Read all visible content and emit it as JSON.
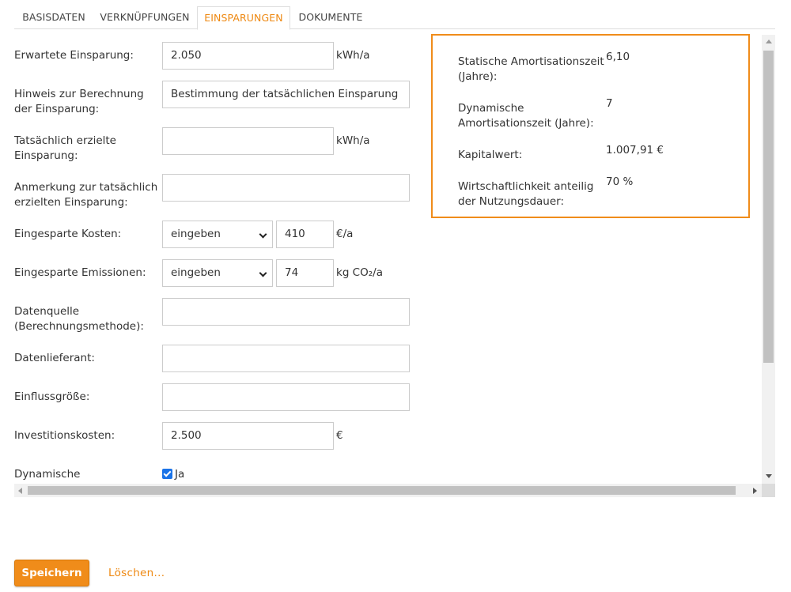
{
  "tabs": [
    {
      "label": "BASISDATEN",
      "active": false
    },
    {
      "label": "VERKNÜPFUNGEN",
      "active": false
    },
    {
      "label": "EINSPARUNGEN",
      "active": true
    },
    {
      "label": "DOKUMENTE",
      "active": false
    }
  ],
  "colors": {
    "accent": "#f08c1a",
    "checkbox": "#1a73e8"
  },
  "form": {
    "expected_savings": {
      "label": "Erwartete Einsparung:",
      "value": "2.050",
      "unit": "kWh/a"
    },
    "calc_note": {
      "label": "Hinweis zur Berechnung der Einsparung:",
      "value": "Bestimmung der tatsächlichen Einsparung"
    },
    "actual_savings": {
      "label": "Tatsächlich erzielte Einsparung:",
      "value": "",
      "unit": "kWh/a"
    },
    "actual_note": {
      "label": "Anmerkung zur tatsächlich erzielten Einsparung:",
      "value": ""
    },
    "saved_costs": {
      "label": "Eingesparte Kosten:",
      "mode": "eingeben",
      "value": "410",
      "unit": "€/a"
    },
    "saved_emissions": {
      "label": "Eingesparte Emissionen:",
      "mode": "eingeben",
      "value": "74",
      "unit": "kg CO₂/a"
    },
    "data_source": {
      "label": "Datenquelle (Berechnungsmethode):",
      "value": ""
    },
    "data_supplier": {
      "label": "Datenlieferant:",
      "value": ""
    },
    "influence": {
      "label": "Einflussgröße:",
      "value": ""
    },
    "investment": {
      "label": "Investitionskosten:",
      "value": "2.500",
      "unit": "€"
    },
    "dynamic": {
      "label": "Dynamische",
      "checkbox_label": "Ja",
      "checked": true
    }
  },
  "summary": {
    "static_payback": {
      "label": "Statische Amortisationszeit (Jahre):",
      "value": "6,10"
    },
    "dynamic_payback": {
      "label": "Dynamische Amortisationszeit (Jahre):",
      "value": "7"
    },
    "net_present_value": {
      "label": "Kapitalwert:",
      "value": "1.007,91 €"
    },
    "economic_share": {
      "label": "Wirtschaftlichkeit anteilig der Nutzungsdauer:",
      "value": "70 %"
    }
  },
  "footer": {
    "save_label": "Speichern",
    "delete_label": "Löschen..."
  }
}
